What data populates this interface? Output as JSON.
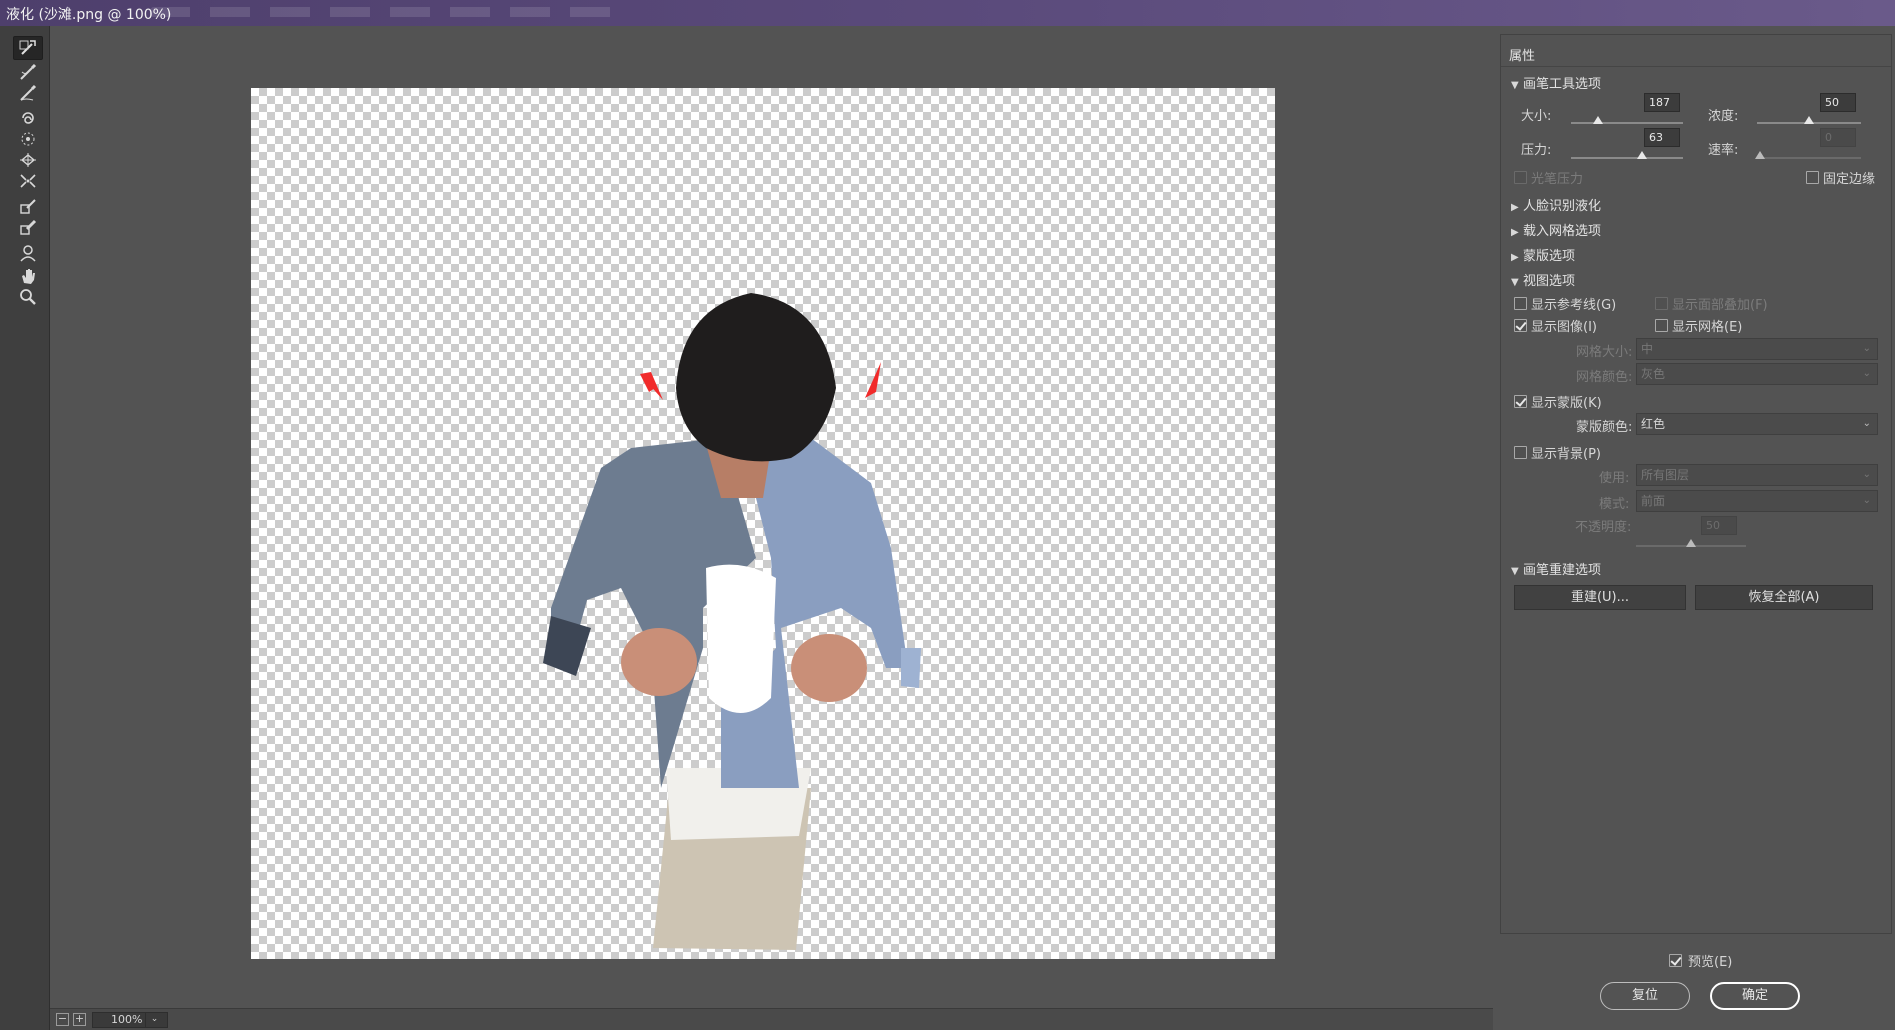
{
  "window": {
    "title": "液化 (沙滩.png @ 100%)"
  },
  "tools": [
    {
      "name": "forward-warp-tool-icon",
      "active": true
    },
    {
      "name": "reconstruct-tool-icon"
    },
    {
      "name": "smooth-tool-icon"
    },
    {
      "name": "twirl-clockwise-tool-icon"
    },
    {
      "name": "pucker-tool-icon"
    },
    {
      "name": "bloat-tool-icon"
    },
    {
      "name": "push-left-tool-icon"
    },
    {
      "name": "freeze-mask-tool-icon"
    },
    {
      "name": "thaw-mask-tool-icon"
    },
    {
      "name": "face-tool-icon"
    },
    {
      "name": "hand-tool-icon"
    },
    {
      "name": "zoom-tool-icon"
    }
  ],
  "statusbar": {
    "zoom_out": "−",
    "zoom_in": "+",
    "zoom_value": "100%",
    "zoom_dropdown": "⌄"
  },
  "properties": {
    "header": "属性",
    "brush_tool_options": {
      "title": "画笔工具选项",
      "size_label": "大小:",
      "size_value": "187",
      "density_label": "浓度:",
      "density_value": "50",
      "pressure_label": "压力:",
      "pressure_value": "63",
      "rate_label": "速率:",
      "rate_value": "0",
      "stylus_pressure_label": "光笔压力",
      "pin_edges_label": "固定边缘"
    },
    "face_aware_liquify": {
      "title": "人脸识别液化"
    },
    "load_mesh_options": {
      "title": "载入网格选项"
    },
    "mask_options": {
      "title": "蒙版选项"
    },
    "view_options": {
      "title": "视图选项",
      "show_guides_label": "显示参考线(G)",
      "show_face_overlay_label": "显示面部叠加(F)",
      "show_image_label": "显示图像(I)",
      "show_mesh_label": "显示网格(E)",
      "mesh_size_label": "网格大小:",
      "mesh_size_value": "中",
      "mesh_color_label": "网格颜色:",
      "mesh_color_value": "灰色",
      "show_mask_label": "显示蒙版(K)",
      "mask_color_label": "蒙版颜色:",
      "mask_color_value": "红色",
      "show_backdrop_label": "显示背景(P)",
      "use_label": "使用:",
      "use_value": "所有图层",
      "mode_label": "模式:",
      "mode_value": "前面",
      "opacity_label": "不透明度:",
      "opacity_value": "50"
    },
    "brush_reconstruct_options": {
      "title": "画笔重建选项",
      "reconstruct_button": "重建(U)...",
      "restore_all_button": "恢复全部(A)"
    },
    "preview_label": "预览(E)",
    "reset_button": "复位",
    "ok_button": "确定"
  }
}
